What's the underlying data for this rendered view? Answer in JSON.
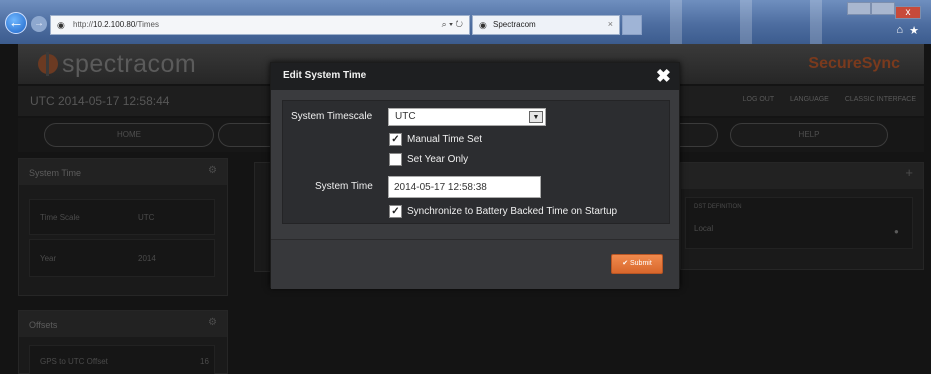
{
  "browser": {
    "url_prefix": "http://",
    "url_host": "10.2.100.80",
    "url_path": "/Times",
    "search_tools": "⌕ ▾ ↻",
    "tab_title": "Spectracom",
    "tab_close": "×",
    "home_icon": "⌂",
    "star_icon": "★",
    "close_x": "x"
  },
  "header": {
    "logo_text": "spectracom",
    "product": "SecureSync",
    "clock": "UTC 2014-05-17 12:58:44",
    "links": [
      "LOG OUT",
      "LANGUAGE",
      "CLASSIC INTERFACE"
    ]
  },
  "nav": {
    "items": [
      "HOME",
      "HELP"
    ]
  },
  "panels": {
    "system_time": {
      "title": "System Time",
      "rows": [
        {
          "key": "Time Scale",
          "value": "UTC"
        },
        {
          "key": "Year",
          "value": "2014"
        }
      ]
    },
    "offsets": {
      "title": "Offsets",
      "rows": [
        {
          "key": "GPS to UTC Offset",
          "value": "16"
        }
      ]
    },
    "dst": {
      "header": "DST DEFINITION",
      "value": "Local",
      "add_icon": "+",
      "edit_icon": "●"
    }
  },
  "modal": {
    "title": "Edit System Time",
    "close_glyph": "✖",
    "timescale_label": "System Timescale",
    "timescale_value": "UTC",
    "manual_time_label": "Manual Time Set",
    "manual_time_checked": true,
    "set_year_label": "Set Year Only",
    "set_year_checked": false,
    "system_time_label": "System Time",
    "system_time_value": "2014-05-17 12:58:38",
    "sync_label": "Synchronize to Battery Backed Time on Startup",
    "sync_checked": true,
    "submit_label": "✔ Submit"
  },
  "colors": {
    "accent": "#e07a3f",
    "modal_bg": "#3a3b3e",
    "header_bg": "#1e1f21"
  }
}
